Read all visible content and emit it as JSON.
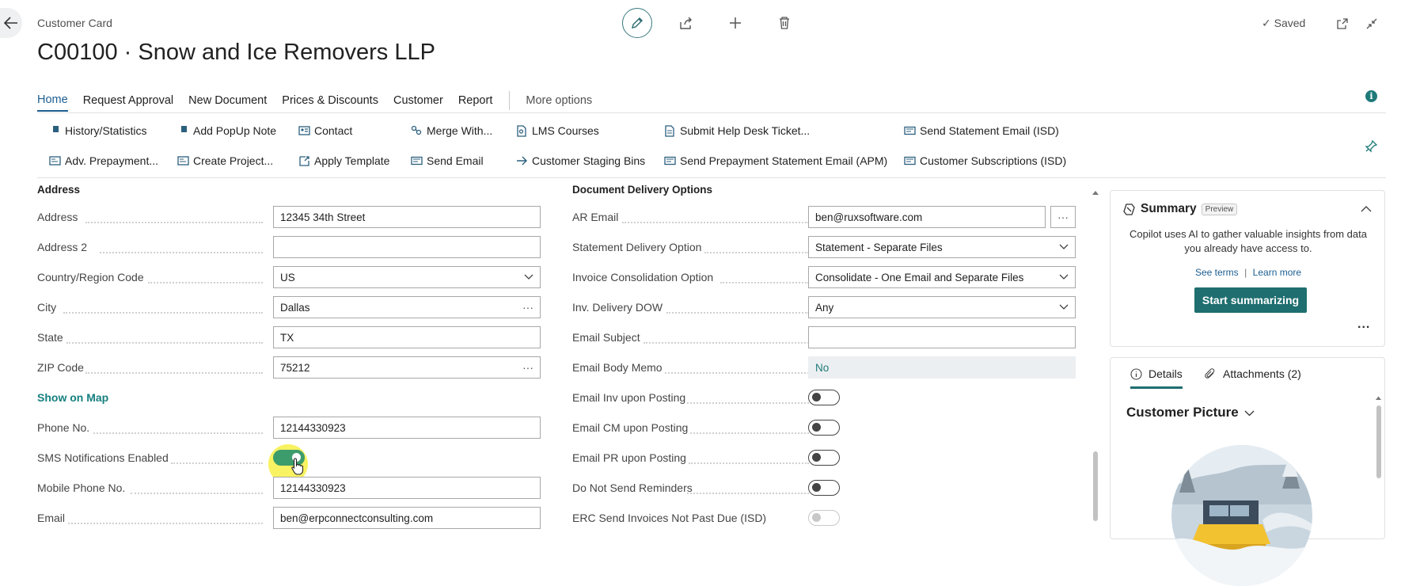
{
  "header": {
    "card_label": "Customer Card",
    "page_title": "C00100 · Snow and Ice Removers LLP",
    "saved_label": "Saved"
  },
  "tabs": [
    {
      "label": "Home",
      "active": true
    },
    {
      "label": "Request Approval"
    },
    {
      "label": "New Document"
    },
    {
      "label": "Prices & Discounts"
    },
    {
      "label": "Customer"
    },
    {
      "label": "Report"
    }
  ],
  "more_options": "More options",
  "actions": {
    "row1": [
      "History/Statistics",
      "Add PopUp Note",
      "Contact",
      "Merge With...",
      "LMS Courses",
      "Submit Help Desk Ticket...",
      "Send Statement Email (ISD)"
    ],
    "row2": [
      "Adv. Prepayment...",
      "Create Project...",
      "Apply Template",
      "Send Email",
      "Customer Staging Bins",
      "Send Prepayment Statement Email (APM)",
      "Customer Subscriptions (ISD)"
    ]
  },
  "address": {
    "section_title": "Address",
    "fields": [
      {
        "label": "Address",
        "value": "12345 34th Street"
      },
      {
        "label": "Address 2",
        "value": ""
      },
      {
        "label": "Country/Region Code",
        "value": "US"
      },
      {
        "label": "City",
        "value": "Dallas"
      },
      {
        "label": "State",
        "value": "TX"
      },
      {
        "label": "ZIP Code",
        "value": "75212"
      }
    ],
    "show_on_map": "Show on Map",
    "phone": {
      "label": "Phone No.",
      "value": "12144330923"
    },
    "sms": {
      "label": "SMS Notifications Enabled",
      "value": true
    },
    "mobile": {
      "label": "Mobile Phone No.",
      "value": "12144330923"
    },
    "email": {
      "label": "Email",
      "value": "ben@erpconnectconsulting.com"
    }
  },
  "delivery": {
    "section_title": "Document Delivery Options",
    "fields": [
      {
        "label": "AR Email",
        "value": "ben@ruxsoftware.com"
      },
      {
        "label": "Statement Delivery Option",
        "value": "Statement - Separate Files"
      },
      {
        "label": "Invoice Consolidation Option",
        "value": "Consolidate - One Email and Separate Files"
      },
      {
        "label": "Inv. Delivery DOW",
        "value": "Any"
      },
      {
        "label": "Email Subject",
        "value": ""
      },
      {
        "label": "Email Body Memo",
        "value": "No"
      }
    ],
    "toggles": [
      {
        "label": "Email Inv upon Posting",
        "value": false
      },
      {
        "label": "Email CM upon Posting",
        "value": false
      },
      {
        "label": "Email PR upon Posting",
        "value": false
      },
      {
        "label": "Do Not Send Reminders",
        "value": false
      },
      {
        "label": "ERC Send Invoices Not Past Due (ISD)",
        "value": false
      }
    ]
  },
  "summary": {
    "title": "Summary",
    "badge": "Preview",
    "description": "Copilot uses AI to gather valuable insights from data you already have access to.",
    "see_terms": "See terms",
    "learn_more": "Learn more",
    "button": "Start summarizing",
    "more": "..."
  },
  "factbox": {
    "details_tab": "Details",
    "attachments_tab": "Attachments (2)",
    "picture_title": "Customer Picture"
  },
  "colors": {
    "accent": "#1f6e70",
    "link": "#17807f",
    "tab_active": "#1d5e91",
    "toggle_on": "#3d9c6b"
  }
}
